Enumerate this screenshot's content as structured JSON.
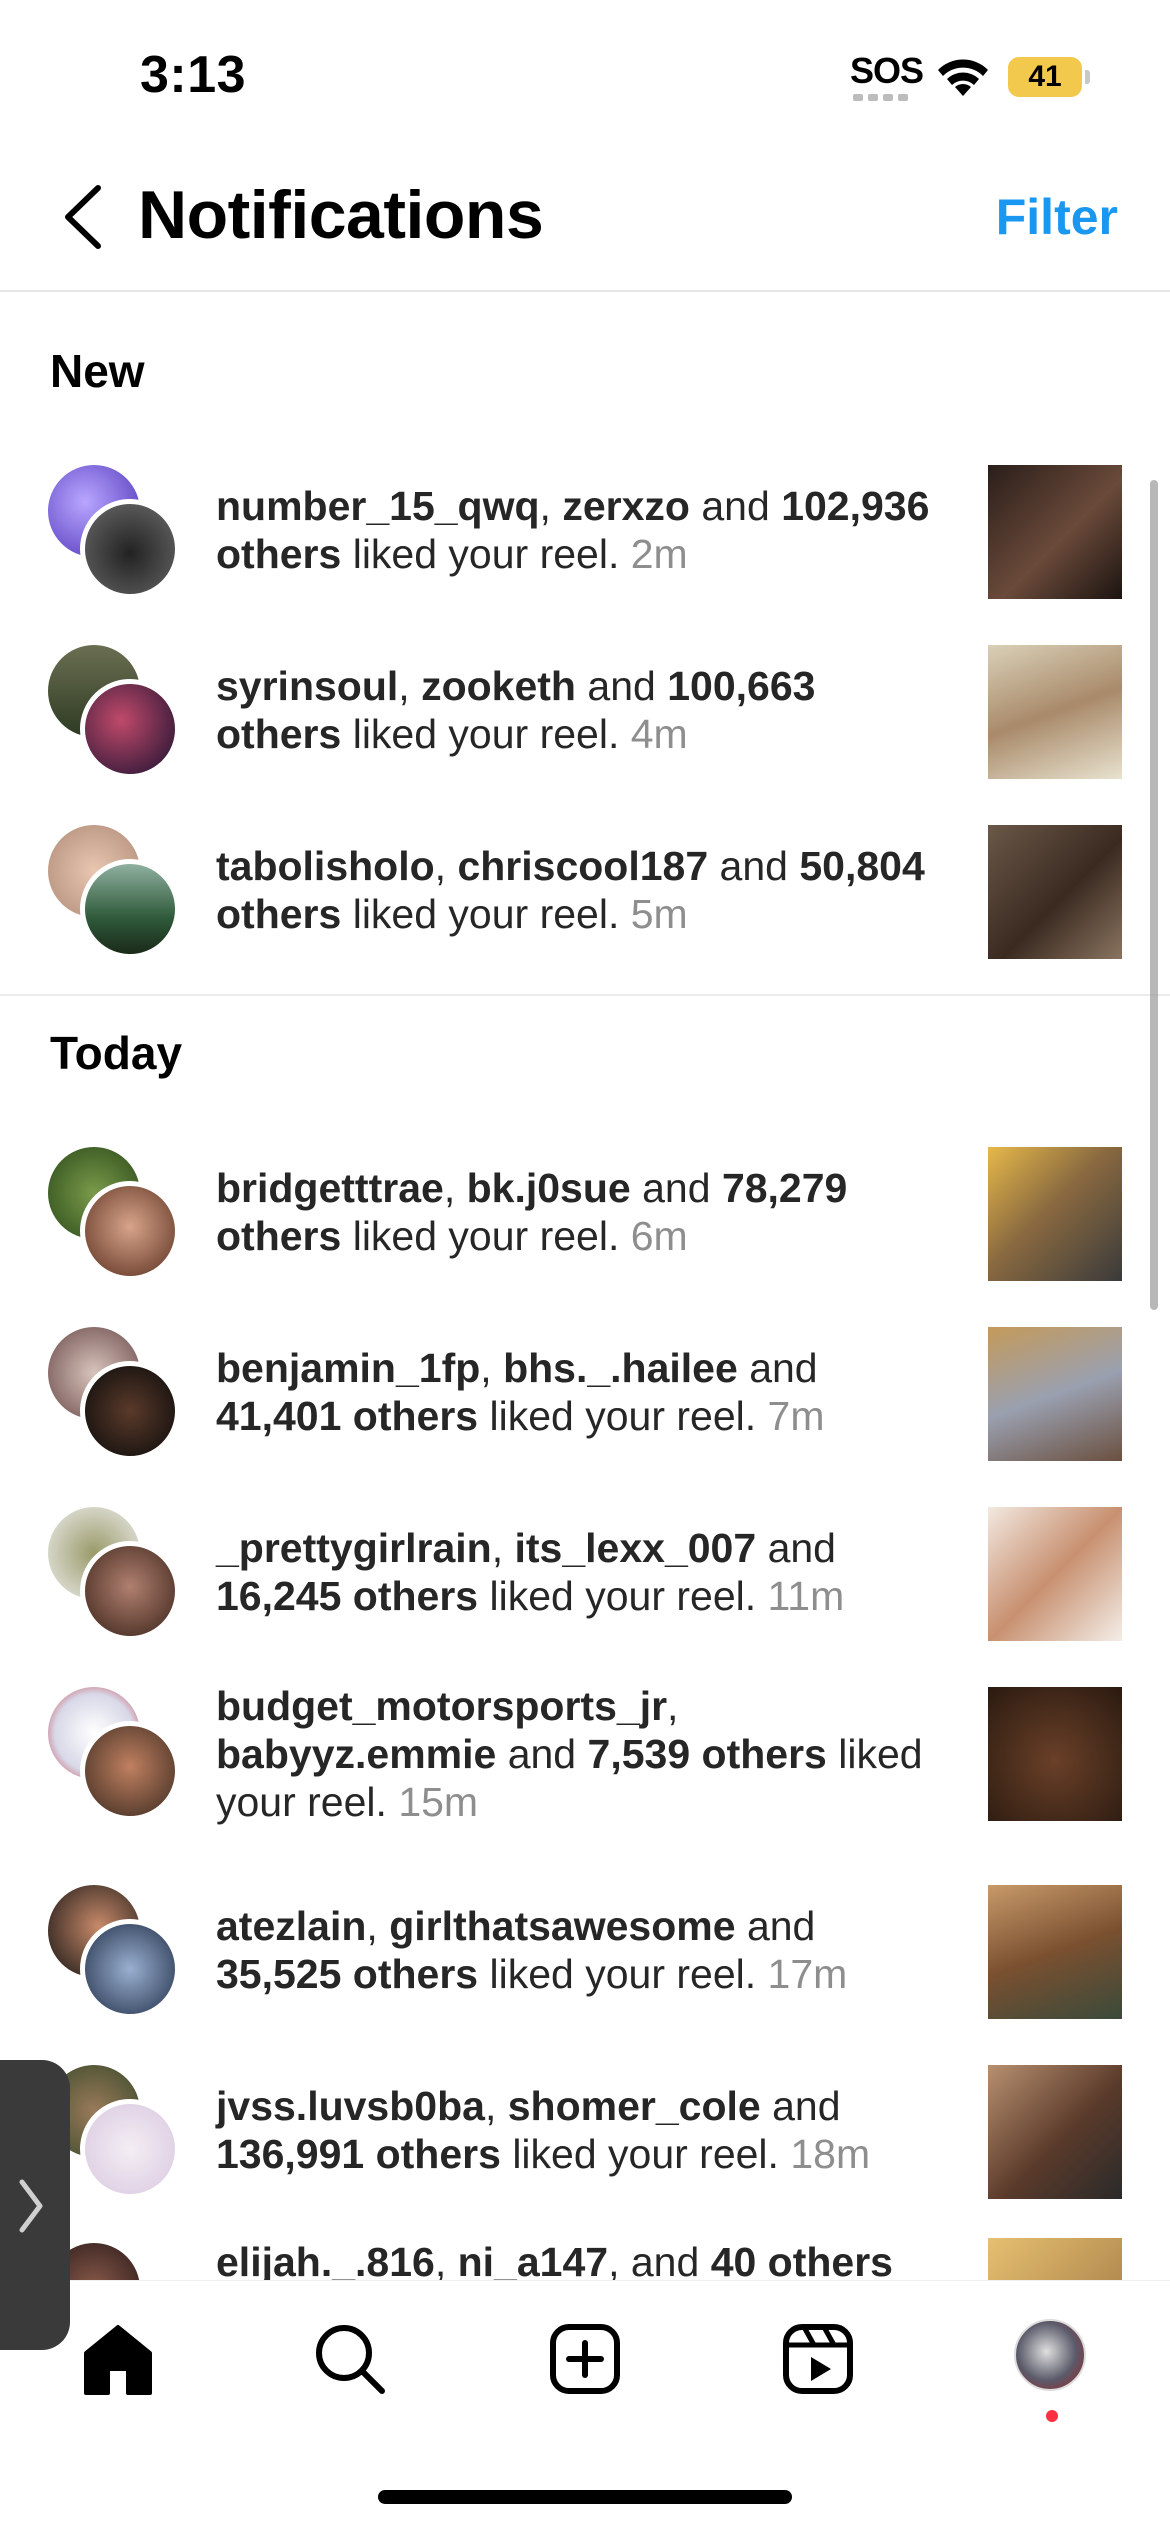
{
  "status_bar": {
    "time": "3:13",
    "sos": "SOS",
    "battery": "41",
    "battery_color": "#f2c94c"
  },
  "header": {
    "back_icon": "chevron-left-icon",
    "title": "Notifications",
    "filter_label": "Filter",
    "accent_color": "#1a97f0"
  },
  "sections": {
    "new": "New",
    "today": "Today"
  },
  "notifications": [
    {
      "user1": "number_15_qwq",
      "user2": "zerxzo",
      "joiner": "and",
      "count": "102,936 others",
      "action": "liked your reel.",
      "time": "2m"
    },
    {
      "user1": "syrinsoul",
      "user2": "zooketh",
      "joiner": "and",
      "count": "100,663 others",
      "action": "liked your reel.",
      "time": "4m"
    },
    {
      "user1": "tabolisholo",
      "user2": "chriscool187",
      "joiner": "and",
      "count": "50,804 others",
      "action": "liked your reel.",
      "time": "5m"
    },
    {
      "user1": "bridgetttrae",
      "user2": "bk.j0sue",
      "joiner": "and",
      "count": "78,279 others",
      "action": "liked your reel.",
      "time": "6m"
    },
    {
      "user1": "benjamin_1fp",
      "user2": "bhs._.hailee",
      "joiner": "and",
      "count": "41,401 others",
      "action": "liked your reel.",
      "time": "7m"
    },
    {
      "user1": "_prettygirlrain",
      "user2": "its_lexx_007",
      "joiner": "and",
      "count": "16,245 others",
      "action": "liked your reel.",
      "time": "11m"
    },
    {
      "user1": "budget_motorsports_jr",
      "user2": "babyyz.emmie",
      "joiner": "and",
      "count": "7,539 others",
      "action": "liked your reel.",
      "time": "15m"
    },
    {
      "user1": "atezlain",
      "user2": "girlthatsawesome",
      "joiner": "and",
      "count": "35,525 others",
      "action": "liked your reel.",
      "time": "17m"
    },
    {
      "user1": "jvss.luvsb0ba",
      "user2": "shomer_cole",
      "joiner": "and",
      "count": "136,991 others",
      "action": "liked your reel.",
      "time": "18m"
    },
    {
      "user1": "elijah._.816",
      "user2": "ni_a147",
      "joiner": ", and",
      "count": "40 others",
      "action": "",
      "time": ""
    }
  ],
  "tabbar": {
    "home": "home-icon",
    "search": "search-icon",
    "create": "create-plus-icon",
    "reels": "reels-icon",
    "profile": "profile-avatar"
  }
}
